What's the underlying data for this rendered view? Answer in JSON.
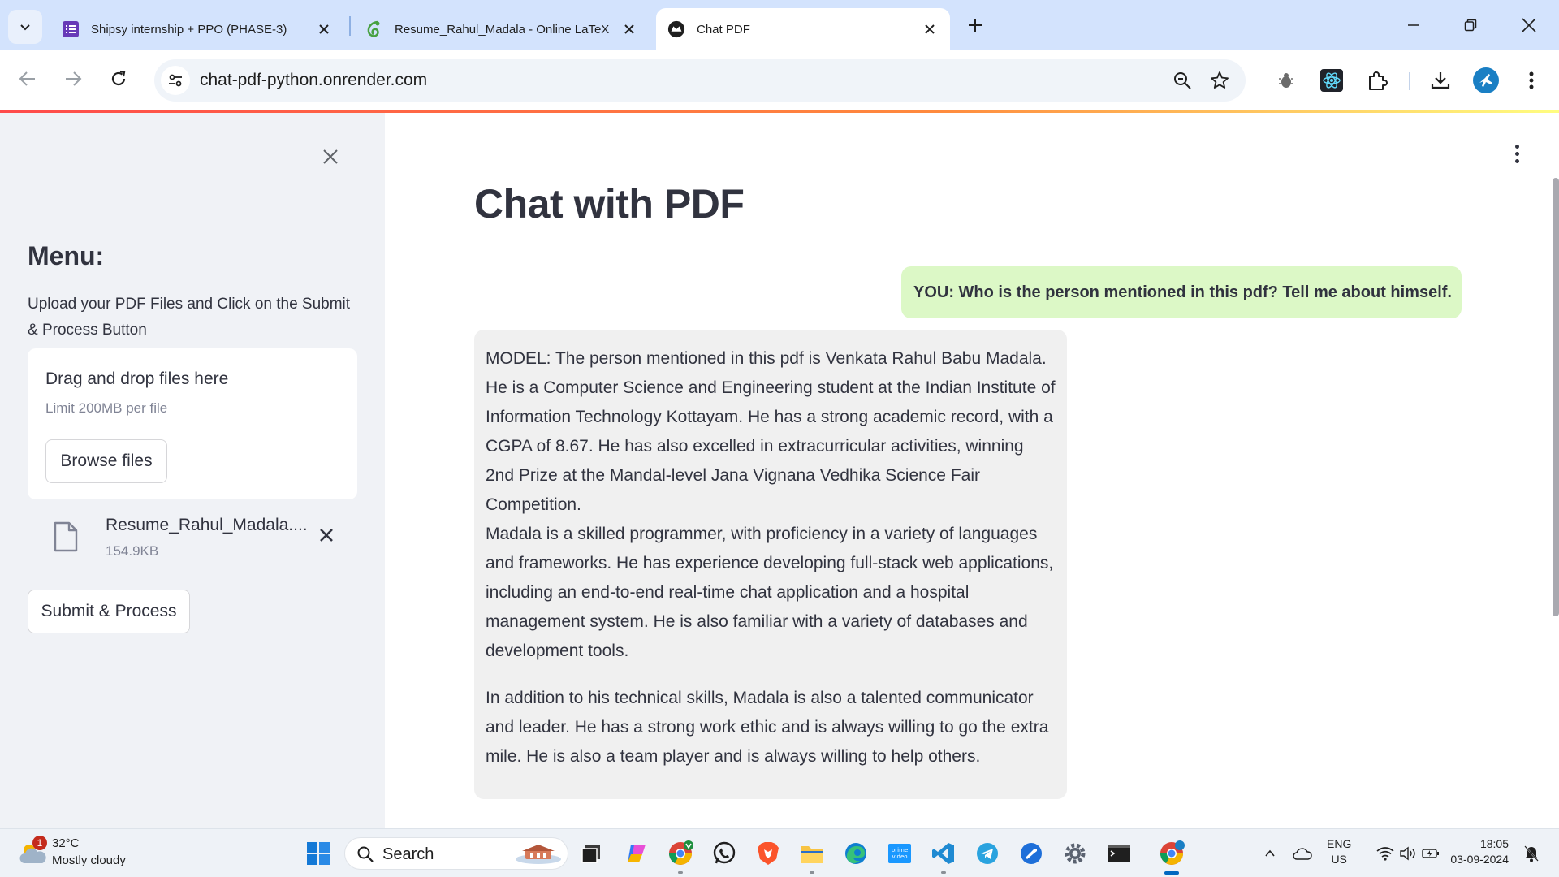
{
  "browser": {
    "tabs": [
      {
        "title": "Shipsy internship + PPO (PHASE-3)",
        "icon": "forms-icon"
      },
      {
        "title": "Resume_Rahul_Madala - Online LaTeX",
        "icon": "overleaf-icon"
      },
      {
        "title": "Chat PDF",
        "icon": "streamlit-icon",
        "active": true
      }
    ],
    "url": "chat-pdf-python.onrender.com"
  },
  "sidebar": {
    "heading": "Menu:",
    "description": "Upload your PDF Files and Click on the Submit & Process Button",
    "dropzone": {
      "title": "Drag and drop files here",
      "limit": "Limit 200MB per file",
      "browse_label": "Browse files"
    },
    "file": {
      "name": "Resume_Rahul_Madala....",
      "size": "154.9KB"
    },
    "submit_label": "Submit & Process"
  },
  "main": {
    "title": "Chat with PDF",
    "messages": [
      {
        "role": "user",
        "text": "YOU: Who is the person mentioned in this pdf? Tell me about himself."
      },
      {
        "role": "model",
        "paragraphs": [
          "MODEL: The person mentioned in this pdf is Venkata Rahul Babu Madala. He is a Computer Science and Engineering student at the Indian Institute of Information Technology Kottayam. He has a strong academic record, with a CGPA of 8.67. He has also excelled in extracurricular activities, winning 2nd Prize at the Mandal-level Jana Vignana Vedhika Science Fair Competition.\nMadala is a skilled programmer, with proficiency in a variety of languages and frameworks. He has experience developing full-stack web applications, including an end-to-end real-time chat application and a hospital management system. He is also familiar with a variety of databases and development tools.",
          "In addition to his technical skills, Madala is also a talented communicator and leader. He has a strong work ethic and is always willing to go the extra mile. He is also a team player and is always willing to help others."
        ]
      }
    ]
  },
  "taskbar": {
    "weather": {
      "badge": "1",
      "temp": "32°C",
      "desc": "Mostly cloudy"
    },
    "search_label": "Search",
    "lang": {
      "line1": "ENG",
      "line2": "US"
    },
    "clock": {
      "time": "18:05",
      "date": "03-09-2024"
    }
  },
  "colors": {
    "accent": "#ff4b4b",
    "user_bubble": "#dcf8c6",
    "model_bubble": "#f0f0f0",
    "sidebar_bg": "#f0f2f6",
    "tabstrip_bg": "#d3e3fd"
  }
}
